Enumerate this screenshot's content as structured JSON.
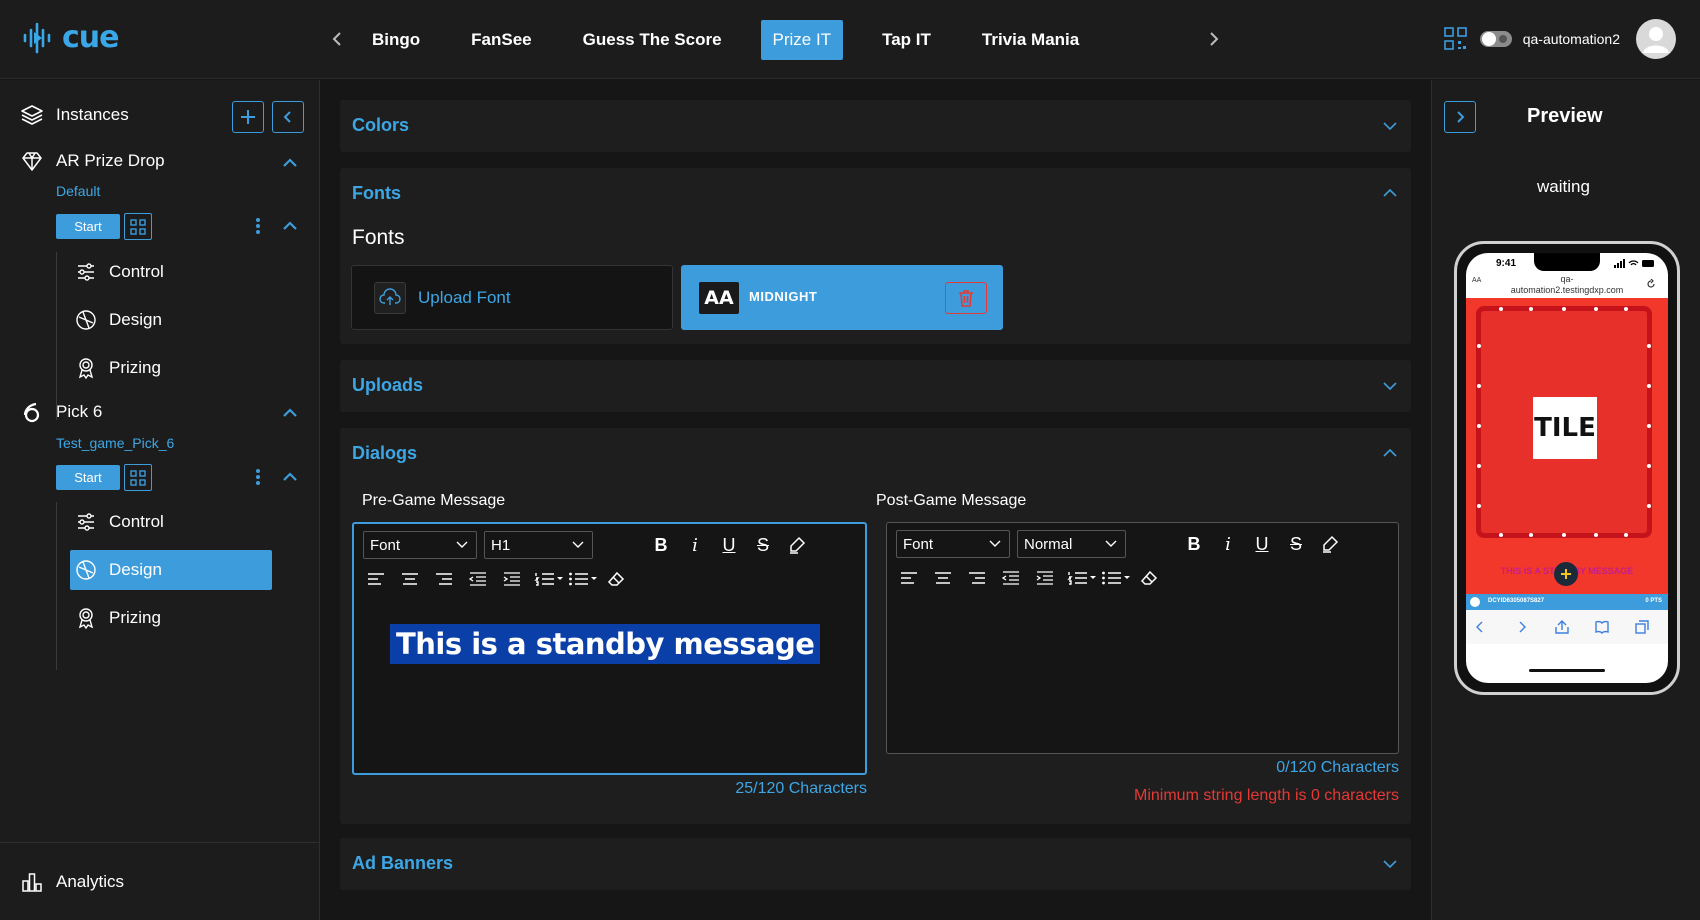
{
  "app": {
    "logo_text": "cue"
  },
  "topnav": {
    "tabs": [
      {
        "label": "Bingo"
      },
      {
        "label": "FanSee"
      },
      {
        "label": "Guess The Score"
      },
      {
        "label": "Prize IT"
      },
      {
        "label": "Tap IT"
      },
      {
        "label": "Trivia Mania"
      }
    ],
    "active_tab": "Prize IT",
    "username": "qa-automation2"
  },
  "sidebar": {
    "instances_label": "Instances",
    "groups": [
      {
        "name": "AR Prize Drop",
        "subtitle": "Default",
        "start_label": "Start",
        "items": [
          {
            "label": "Control"
          },
          {
            "label": "Design"
          },
          {
            "label": "Prizing"
          }
        ]
      },
      {
        "name": "Pick 6",
        "subtitle": "Test_game_Pick_6",
        "start_label": "Start",
        "items": [
          {
            "label": "Control"
          },
          {
            "label": "Design"
          },
          {
            "label": "Prizing"
          }
        ],
        "active_item": "Design"
      }
    ],
    "analytics_label": "Analytics"
  },
  "main": {
    "colors_title": "Colors",
    "fonts_title": "Fonts",
    "fonts_label": "Fonts",
    "upload_font_label": "Upload Font",
    "font_badge": "AA",
    "font_name": "MIDNIGHT",
    "uploads_title": "Uploads",
    "dialogs_title": "Dialogs",
    "pre_game": {
      "label": "Pre-Game Message",
      "font_select": "Font",
      "size_select": "H1",
      "content": "This is a standby message",
      "counter": "25/120 Characters"
    },
    "post_game": {
      "label": "Post-Game Message",
      "font_select": "Font",
      "size_select": "Normal",
      "counter": "0/120 Characters",
      "error": "Minimum string length is 0 characters"
    },
    "ad_banners_title": "Ad Banners"
  },
  "preview": {
    "title": "Preview",
    "status": "waiting",
    "phone": {
      "time": "9:41",
      "url_line1": "qa-",
      "url_line2": "automation2.testingdxp.com",
      "tile_text": "TILE",
      "bottom_bar_id": "DCYID6305087S827",
      "bottom_bar_pts": "0 PTS",
      "marquee": "THIS IS A STANDBY MESSAGE"
    }
  },
  "colors": {
    "accent": "#3d9cdb",
    "link": "#3da7e6",
    "danger": "#e53935",
    "preview_red": "#f2372b"
  }
}
